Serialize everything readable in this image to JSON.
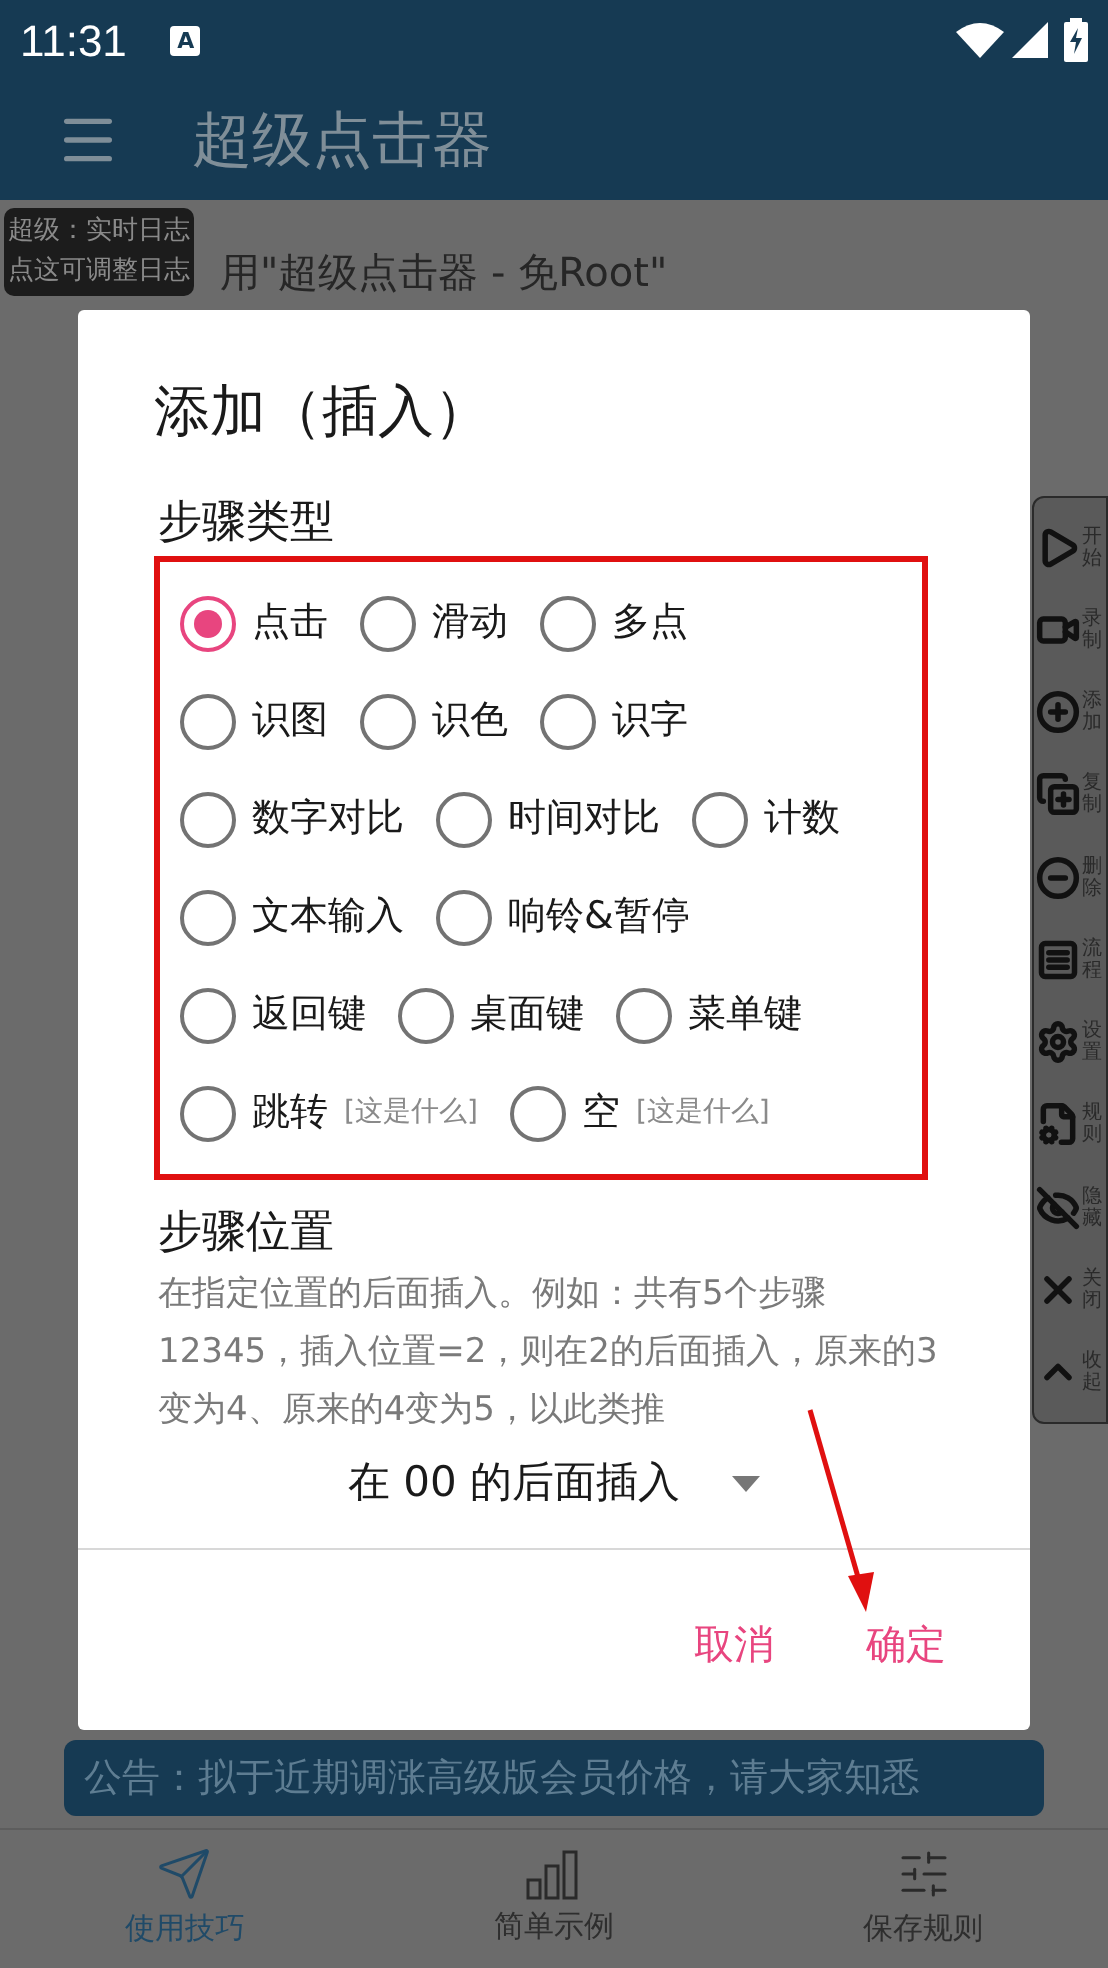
{
  "status_bar": {
    "time": "11:31",
    "notification_badge": "A"
  },
  "toolbar": {
    "title": "超级点击器"
  },
  "log_tooltip": {
    "lines": [
      "超级：实时日志",
      "点这可调整日志"
    ]
  },
  "welcome_text": "用\"超级点击器 - 免Root\"",
  "floating_toolbar": [
    {
      "label": "开始"
    },
    {
      "label": "录制"
    },
    {
      "label": "添加"
    },
    {
      "label": "复制"
    },
    {
      "label": "删除"
    },
    {
      "label": "流程"
    },
    {
      "label": "设置"
    },
    {
      "label": "规则"
    },
    {
      "label": "隐藏"
    },
    {
      "label": "关闭"
    },
    {
      "label": "收起"
    }
  ],
  "dialog": {
    "title": "添加（插入）",
    "step_type_label": "步骤类型",
    "options": [
      [
        {
          "label": "点击",
          "selected": true
        },
        {
          "label": "滑动",
          "selected": false
        },
        {
          "label": "多点",
          "selected": false
        }
      ],
      [
        {
          "label": "识图",
          "selected": false
        },
        {
          "label": "识色",
          "selected": false
        },
        {
          "label": "识字",
          "selected": false
        }
      ],
      [
        {
          "label": "数字对比",
          "selected": false
        },
        {
          "label": "时间对比",
          "selected": false
        },
        {
          "label": "计数",
          "selected": false
        }
      ],
      [
        {
          "label": "文本输入",
          "selected": false
        },
        {
          "label": "响铃&暂停",
          "selected": false
        }
      ],
      [
        {
          "label": "返回键",
          "selected": false
        },
        {
          "label": "桌面键",
          "selected": false
        },
        {
          "label": "菜单键",
          "selected": false
        }
      ],
      [
        {
          "label": "跳转",
          "hint": "[这是什么]",
          "selected": false
        },
        {
          "label": "空",
          "hint": "[这是什么]",
          "selected": false
        }
      ]
    ],
    "step_position_label": "步骤位置",
    "description": "在指定位置的后面插入。例如：共有5个步骤12345，插入位置=2，则在2的后面插入，原来的3变为4、原来的4变为5，以此类推",
    "position_dropdown": "在 00 的后面插入",
    "buttons": [
      "取消",
      "确定"
    ]
  },
  "announcement": "公告：拟于近期调涨高级版会员价格，请大家知悉",
  "bottom_nav": [
    {
      "label": "使用技巧",
      "selected": true
    },
    {
      "label": "简单示例",
      "selected": false
    },
    {
      "label": "保存规则",
      "selected": false
    }
  ]
}
